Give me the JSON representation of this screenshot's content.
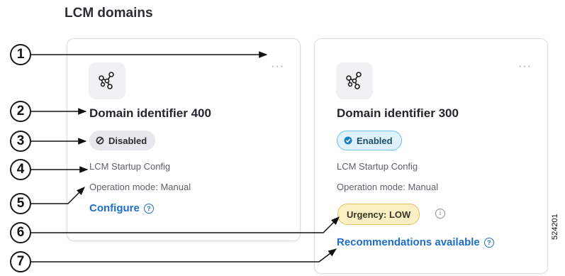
{
  "page": {
    "title": "LCM domains"
  },
  "cards": [
    {
      "more_icon": "···",
      "name": "Domain identifier 400",
      "status": "Disabled",
      "status_icon": "disabled-icon",
      "startup": "LCM Startup Config",
      "mode": "Operation mode: Manual",
      "action": "Configure"
    },
    {
      "more_icon": "···",
      "name": "Domain identifier 300",
      "status": "Enabled",
      "status_icon": "check-circle-icon",
      "startup": "LCM Startup Config",
      "mode": "Operation mode: Manual",
      "urgency": "Urgency: LOW",
      "action": "Recommendations available"
    }
  ],
  "callouts": [
    "1",
    "2",
    "3",
    "4",
    "5",
    "6",
    "7"
  ],
  "help_glyph": "?",
  "info_glyph": "i",
  "figure_id": "524201",
  "colors": {
    "link": "#1e6ec8",
    "enabled_bg": "#dff1fb",
    "enabled_border": "#6cc1ea",
    "disabled_bg": "#e6e8eb",
    "urgency_bg": "#fbf0c4",
    "urgency_border": "#e1c35e"
  }
}
